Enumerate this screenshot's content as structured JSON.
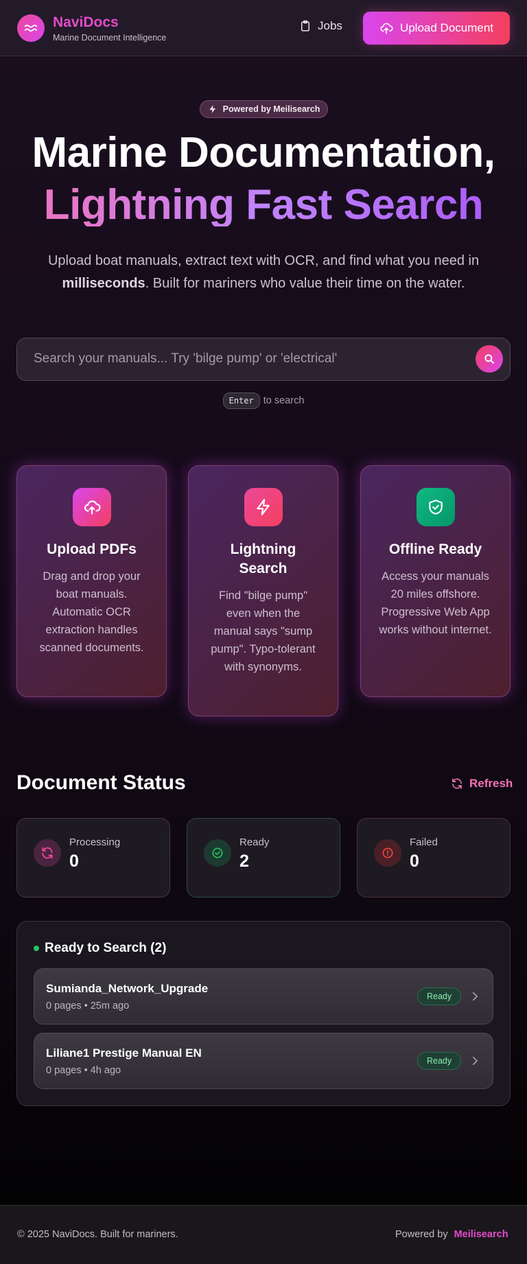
{
  "header": {
    "brand_name": "NaviDocs",
    "brand_subtitle": "Marine Document Intelligence",
    "jobs_label": "Jobs",
    "upload_label": "Upload Document"
  },
  "hero": {
    "badge": "Powered by Meilisearch",
    "title_line1": "Marine Documentation,",
    "title_line2": "Lightning Fast Search",
    "desc_part1": "Upload boat manuals, extract text with OCR, and find what you need in ",
    "desc_bold": "milliseconds",
    "desc_part2": ". Built for mariners who value their time on the water."
  },
  "search": {
    "placeholder": "Search your manuals... Try 'bilge pump' or 'electrical'",
    "value": "",
    "hint_key": "Enter",
    "hint_text": "to search"
  },
  "features": [
    {
      "icon": "cloud-upload-icon",
      "title": "Upload PDFs",
      "desc": "Drag and drop your boat manuals. Automatic OCR extraction handles scanned documents."
    },
    {
      "icon": "lightning-icon",
      "title": "Lightning Search",
      "desc": "Find \"bilge pump\" even when the manual says \"sump pump\". Typo-tolerant with synonyms."
    },
    {
      "icon": "shield-check-icon",
      "title": "Offline Ready",
      "desc": "Access your manuals 20 miles offshore. Progressive Web App works without internet."
    }
  ],
  "status": {
    "title": "Document Status",
    "refresh_label": "Refresh",
    "cards": [
      {
        "label": "Processing",
        "value": "0",
        "color": "#ec4899"
      },
      {
        "label": "Ready",
        "value": "2",
        "color": "#22c55e"
      },
      {
        "label": "Failed",
        "value": "0",
        "color": "#ef4444"
      }
    ]
  },
  "ready": {
    "title": "Ready to Search (2)",
    "docs": [
      {
        "name": "Sumianda_Network_Upgrade",
        "meta": "0 pages • 25m ago",
        "badge": "Ready"
      },
      {
        "name": "Liliane1 Prestige Manual EN",
        "meta": "0 pages • 4h ago",
        "badge": "Ready"
      }
    ]
  },
  "footer": {
    "copyright": "© 2025 NaviDocs. Built for mariners.",
    "powered_by": "Powered by",
    "powered_name": "Meilisearch"
  },
  "colors": {
    "accent_pink": "#ec4899",
    "accent_magenta": "#d946ef",
    "ready_green": "#22c55e",
    "failed_red": "#ef4444"
  }
}
